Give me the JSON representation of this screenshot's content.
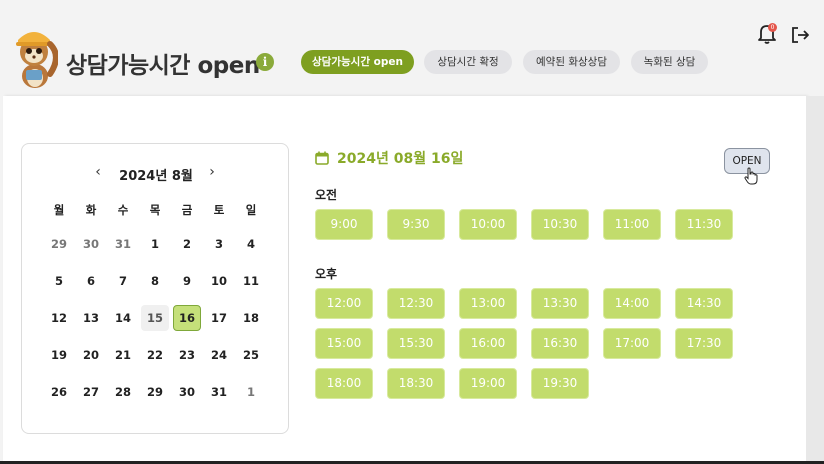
{
  "header": {
    "title": "상담가능시간 open",
    "tabs": [
      {
        "label": "상담가능시간 open",
        "active": true
      },
      {
        "label": "상담시간 확정",
        "active": false
      },
      {
        "label": "예약된 화상상담",
        "active": false
      },
      {
        "label": "녹화된 상담",
        "active": false
      }
    ],
    "notification_count": "0",
    "icons": [
      "mascot-icon",
      "info-icon",
      "bell-icon",
      "logout-icon"
    ]
  },
  "calendar": {
    "month_label": "2024년 8월",
    "prev_symbol": "‹",
    "next_symbol": "›",
    "weekdays": [
      "월",
      "화",
      "수",
      "목",
      "금",
      "토",
      "일"
    ],
    "weeks": [
      [
        "29",
        "30",
        "31",
        "1",
        "2",
        "3",
        "4"
      ],
      [
        "5",
        "6",
        "7",
        "8",
        "9",
        "10",
        "11"
      ],
      [
        "12",
        "13",
        "14",
        "15",
        "16",
        "17",
        "18"
      ],
      [
        "19",
        "20",
        "21",
        "22",
        "23",
        "24",
        "25"
      ],
      [
        "26",
        "27",
        "28",
        "29",
        "30",
        "31",
        "1"
      ]
    ],
    "selected_day": "16",
    "today": "15"
  },
  "schedule": {
    "date_heading": "2024년 08월 16일",
    "open_button": "OPEN",
    "am_label": "오전",
    "pm_label": "오후",
    "am_slots": [
      "9:00",
      "9:30",
      "10:00",
      "10:30",
      "11:00",
      "11:30"
    ],
    "pm_slots": [
      "12:00",
      "12:30",
      "13:00",
      "13:30",
      "14:00",
      "14:30",
      "15:00",
      "15:30",
      "16:00",
      "16:30",
      "17:00",
      "17:30",
      "18:00",
      "18:30",
      "19:00",
      "19:30"
    ]
  },
  "colors": {
    "accent": "#7e9f20",
    "slot": "#c2dc6c",
    "selected_day": "#c5e07a",
    "date_heading": "#8aaa2a",
    "badge": "#e4554a"
  }
}
